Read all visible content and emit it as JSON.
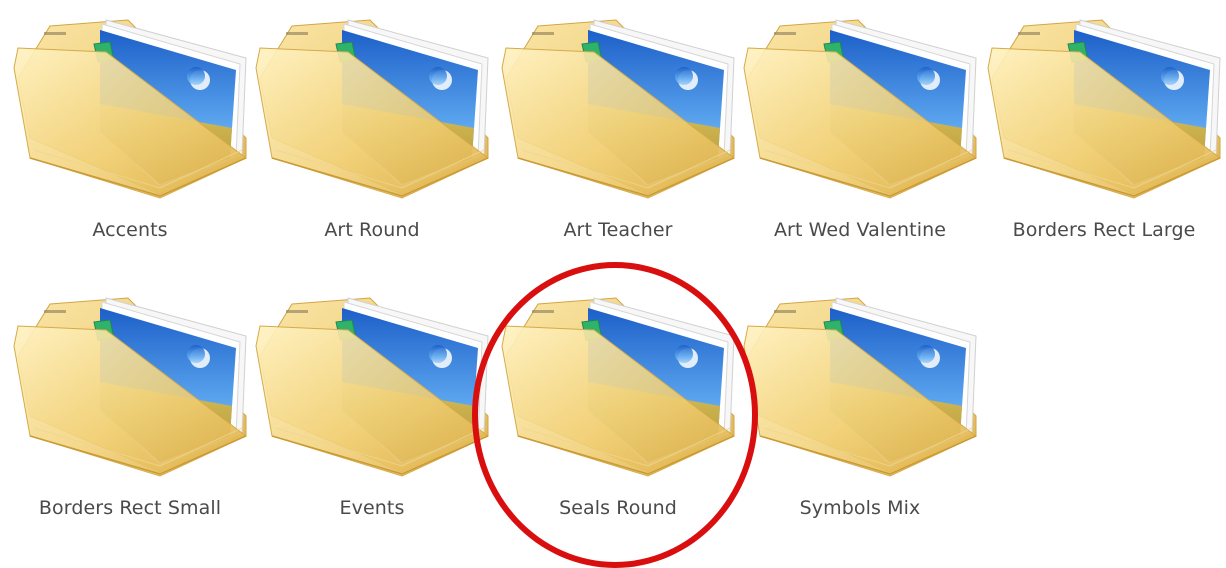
{
  "folders": [
    {
      "name": "Accents"
    },
    {
      "name": "Art Round"
    },
    {
      "name": "Art Teacher"
    },
    {
      "name": "Art Wed Valentine"
    },
    {
      "name": "Borders Rect Large"
    },
    {
      "name": "Borders Rect Small"
    },
    {
      "name": "Events"
    },
    {
      "name": "Seals Round",
      "highlighted": true
    },
    {
      "name": "Symbols Mix"
    }
  ],
  "icon": "pictures-folder-icon",
  "colors": {
    "highlight_ring": "#d90f0f",
    "folder_yellow": "#f3d27a",
    "sky_blue": "#3a7fd8",
    "tab_green": "#2fb36a",
    "label_text": "#4a4a4a"
  }
}
